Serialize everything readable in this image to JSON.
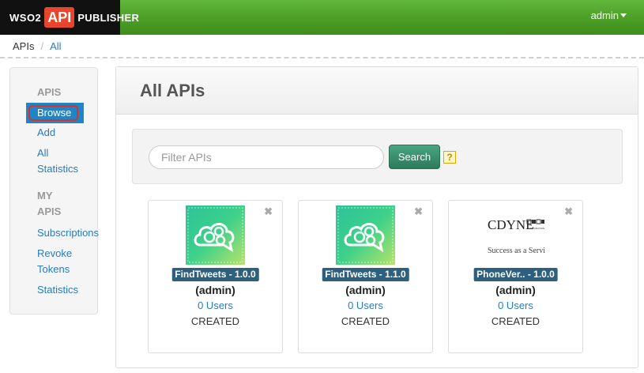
{
  "header": {
    "logo": {
      "wso2": "WSO2",
      "api": "API",
      "publisher": "PUBLISHER"
    },
    "user_menu_label": "admin",
    "colors": {
      "header_green": "#4c9f26",
      "logo_red": "#e8452c"
    }
  },
  "breadcrumb": {
    "root": "APIs",
    "separator": "/",
    "current": "All"
  },
  "sidebar": {
    "sections": [
      {
        "header": "APIS"
      },
      {
        "header": "MY APIS"
      }
    ],
    "apis_header": "APIS",
    "my_apis_header_1": "MY",
    "my_apis_header_2": "APIS",
    "items": {
      "browse": "Browse",
      "add": "Add",
      "all_statistics_1": "All",
      "all_statistics_2": "Statistics",
      "subscriptions": "Subscriptions",
      "revoke_tokens_1": "Revoke",
      "revoke_tokens_2": "Tokens",
      "statistics": "Statistics"
    },
    "active_item": "Browse"
  },
  "main": {
    "title": "All APIs",
    "filter": {
      "placeholder": "Filter APIs",
      "value": ""
    },
    "search_label": "Search",
    "help_label": "?"
  },
  "apis": [
    {
      "badge": "FindTweets - 1.0.0",
      "owner": "(admin)",
      "users": "0 Users",
      "status": "CREATED",
      "close": "✖",
      "thumb": "gear-cloud-icon"
    },
    {
      "badge": "FindTweets - 1.1.0",
      "owner": "(admin)",
      "users": "0 Users",
      "status": "CREATED",
      "close": "✖",
      "thumb": "gear-cloud-icon"
    },
    {
      "badge": "PhoneVer.. - 1.0.0",
      "owner": "(admin)",
      "users": "0 Users",
      "status": "CREATED",
      "close": "✖",
      "thumb": "cdyne-logo",
      "thumb_text": {
        "brand": "CDYNE",
        "corp": "CORPORATION",
        "tagline": "Success as a Service"
      }
    }
  ]
}
